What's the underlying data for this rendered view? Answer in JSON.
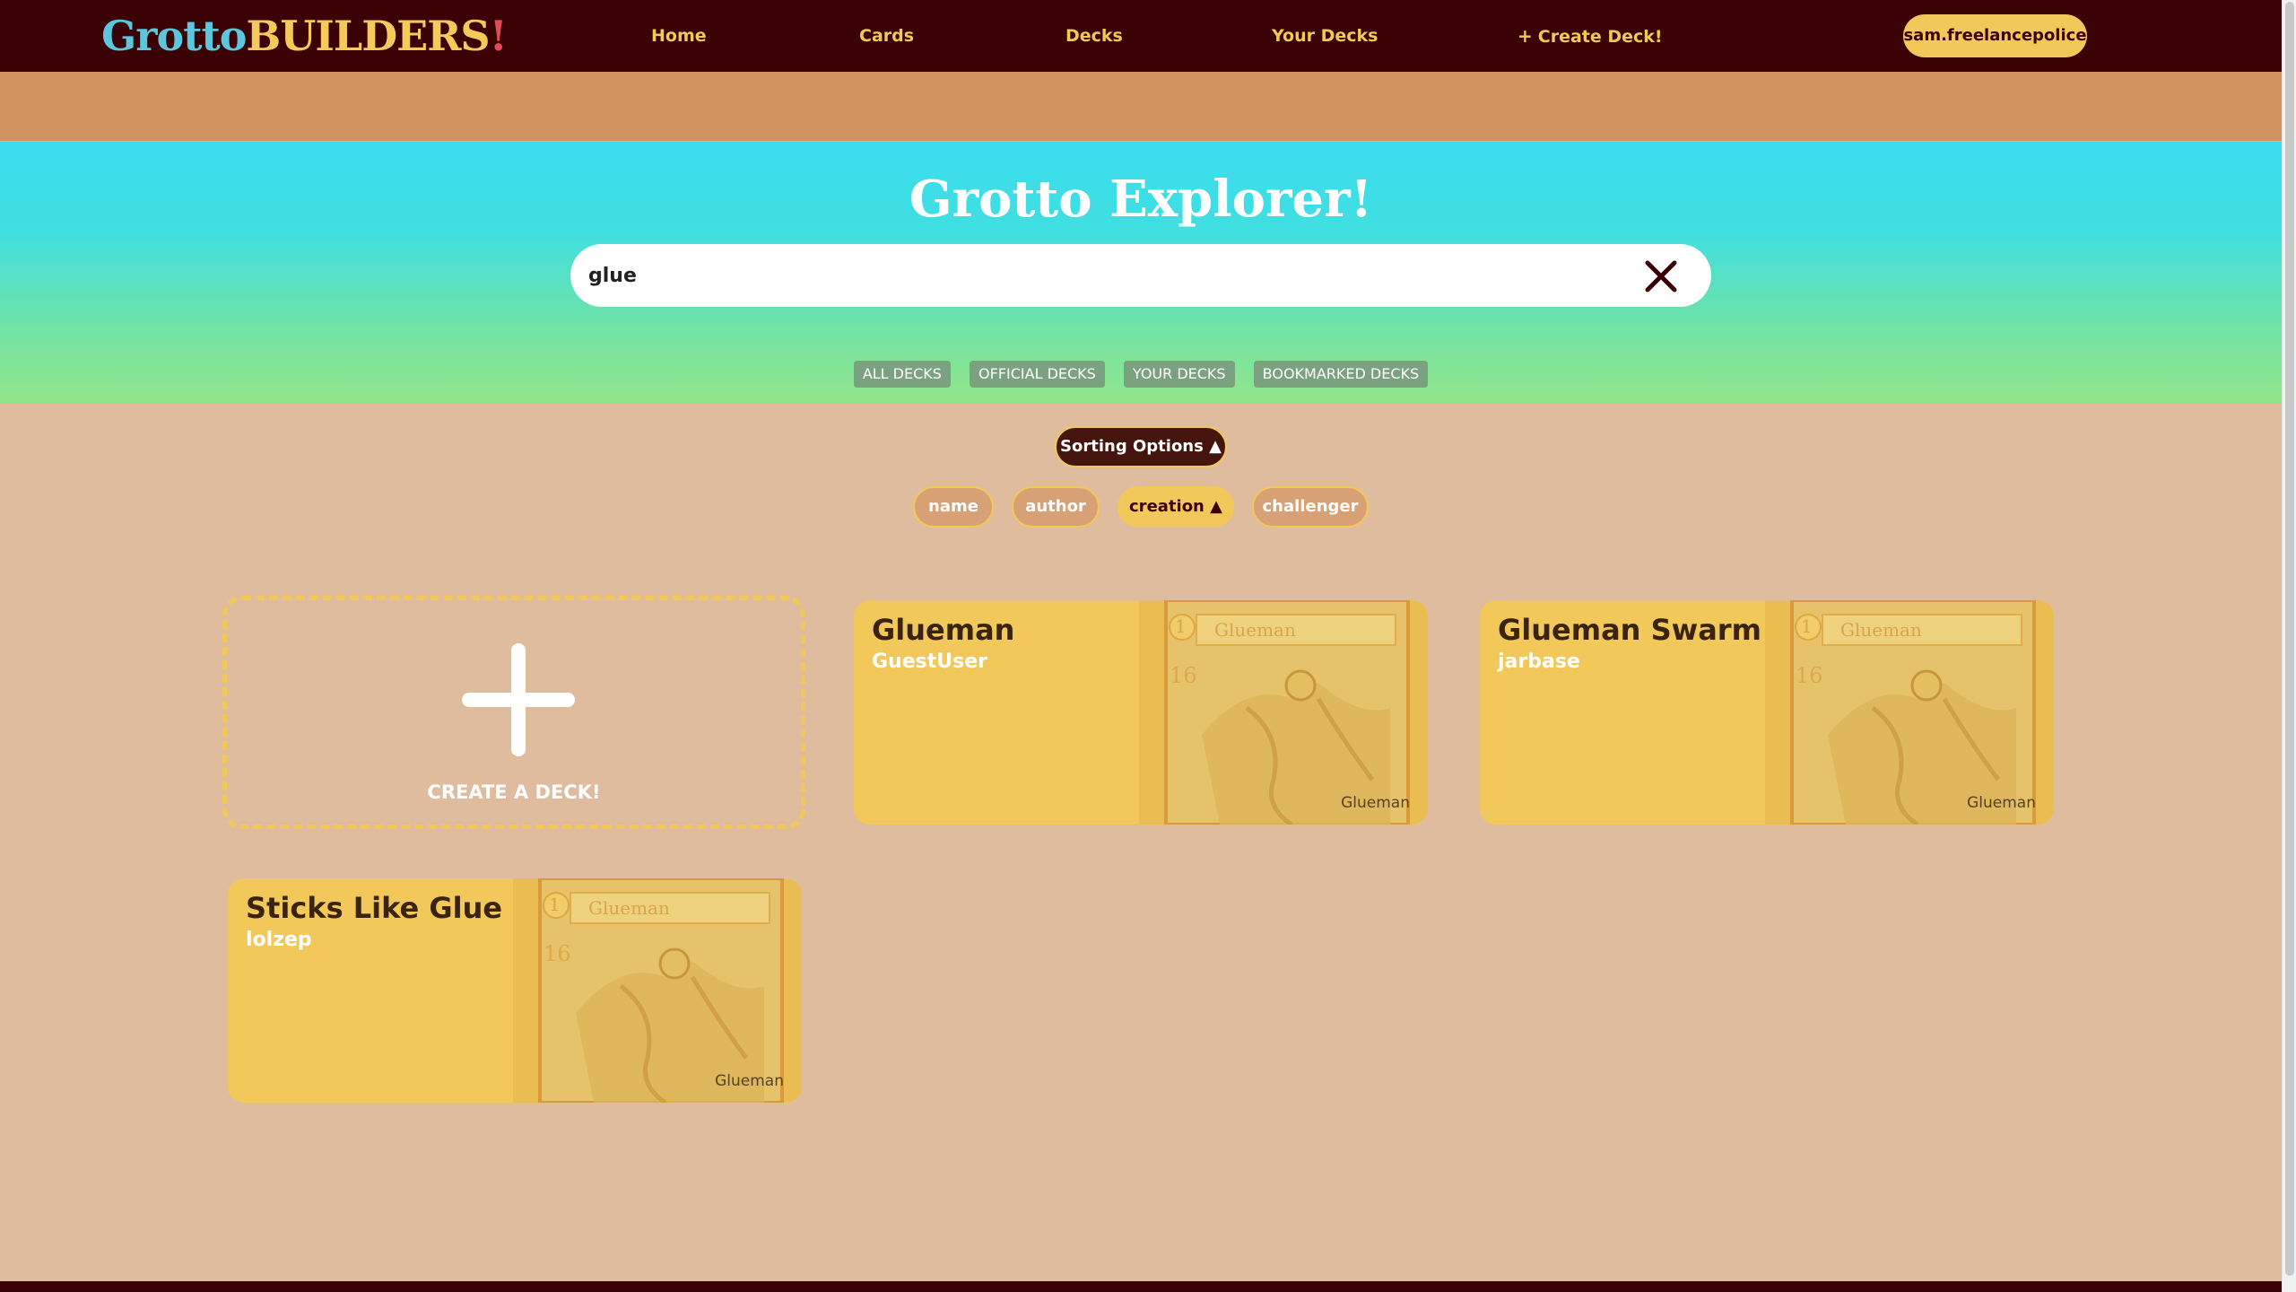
{
  "nav": {
    "logo_part1": "Grotto",
    "logo_part2": "BUILDERS",
    "logo_part3": "!",
    "links": [
      "Home",
      "Cards",
      "Decks",
      "Your Decks"
    ],
    "create_deck": "Create Deck!",
    "create_deck_icon": "plus-icon",
    "user": "sam.freelancepolice"
  },
  "hero": {
    "title": "Grotto Explorer!",
    "search_value": "glue",
    "clear_icon": "close-icon",
    "filters": [
      "ALL DECKS",
      "OFFICIAL DECKS",
      "YOUR DECKS",
      "BOOKMARKED DECKS"
    ]
  },
  "sorting": {
    "toggle_label": "Sorting Options ▲",
    "options": [
      "name",
      "author",
      "creation ▲",
      "challenger"
    ],
    "active_option": "creation"
  },
  "create_card": {
    "label": "CREATE A DECK!",
    "icon": "plus-icon"
  },
  "decks": [
    {
      "title": "Glueman",
      "author": "GuestUser",
      "card_name": "Glueman",
      "card_cost": "1",
      "card_power": "16"
    },
    {
      "title": "Glueman Swarm",
      "author": "jarbase",
      "card_name": "Glueman",
      "card_cost": "1",
      "card_power": "16"
    },
    {
      "title": "Sticks Like Glue",
      "author": "lolzep",
      "card_name": "Glueman",
      "card_cost": "1",
      "card_power": "16"
    }
  ],
  "colors": {
    "nav_bg": "#3a0205",
    "accent_yellow": "#f3c85a",
    "page_bg": "#e0bc9e",
    "hero_top": "#3bdcef",
    "hero_bottom": "#93e48a"
  }
}
